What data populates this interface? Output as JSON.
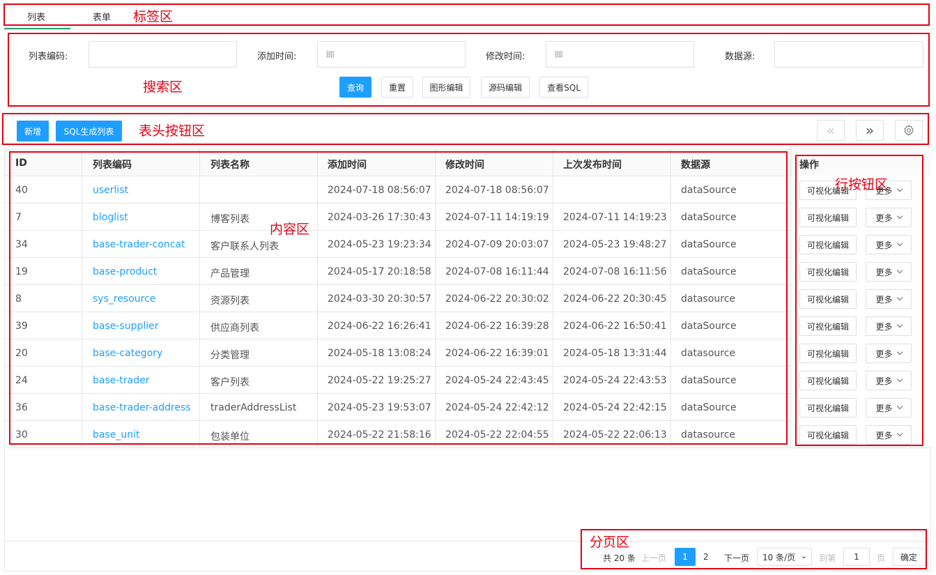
{
  "tabs": [
    {
      "label": "列表"
    },
    {
      "label": "表单"
    }
  ],
  "annotations": {
    "tabs_area": "标签区",
    "search_area": "搜索区",
    "toolbar_area": "表头按钮区",
    "content_area": "内容区",
    "row_buttons_area": "行按钮区",
    "pagination_area": "分页区"
  },
  "search": {
    "code_label": "列表编码:",
    "add_time_label": "添加时间:",
    "modify_time_label": "修改时间:",
    "datasource_label": "数据源:",
    "code_value": "",
    "datasource_value": "",
    "buttons": {
      "query": "查询",
      "reset": "重置",
      "graphic_edit": "图形编辑",
      "source_edit": "源码编辑",
      "view_sql": "查看SQL"
    }
  },
  "toolbar": {
    "add": "新增",
    "sql_generate": "SQL生成列表",
    "prev_icon": "double-chevron-left-icon",
    "next_icon": "double-chevron-right-icon",
    "settings_icon": "gear-icon"
  },
  "table": {
    "columns": [
      "ID",
      "列表编码",
      "列表名称",
      "添加时间",
      "修改时间",
      "上次发布时间",
      "数据源",
      "操作"
    ],
    "rows": [
      {
        "id": "40",
        "code": "userlist",
        "name": "",
        "added": "2024-07-18 08:56:07",
        "modified": "2024-07-18 08:56:07",
        "published": "",
        "datasource": "dataSource"
      },
      {
        "id": "7",
        "code": "bloglist",
        "name": "博客列表",
        "added": "2024-03-26 17:30:43",
        "modified": "2024-07-11 14:19:19",
        "published": "2024-07-11 14:19:23",
        "datasource": "dataSource"
      },
      {
        "id": "34",
        "code": "base-trader-concat",
        "name": "客户联系人列表",
        "added": "2024-05-23 19:23:34",
        "modified": "2024-07-09 20:03:07",
        "published": "2024-05-23 19:48:27",
        "datasource": "dataSource"
      },
      {
        "id": "19",
        "code": "base-product",
        "name": "产品管理",
        "added": "2024-05-17 20:18:58",
        "modified": "2024-07-08 16:11:44",
        "published": "2024-07-08 16:11:56",
        "datasource": "dataSource"
      },
      {
        "id": "8",
        "code": "sys_resource",
        "name": "资源列表",
        "added": "2024-03-30 20:30:57",
        "modified": "2024-06-22 20:30:02",
        "published": "2024-06-22 20:30:45",
        "datasource": "datasource"
      },
      {
        "id": "39",
        "code": "base-supplier",
        "name": "供应商列表",
        "added": "2024-06-22 16:26:41",
        "modified": "2024-06-22 16:39:28",
        "published": "2024-06-22 16:50:41",
        "datasource": "dataSource"
      },
      {
        "id": "20",
        "code": "base-category",
        "name": "分类管理",
        "added": "2024-05-18 13:08:24",
        "modified": "2024-06-22 16:39:01",
        "published": "2024-05-18 13:31:44",
        "datasource": "datasource"
      },
      {
        "id": "24",
        "code": "base-trader",
        "name": "客户列表",
        "added": "2024-05-22 19:25:27",
        "modified": "2024-05-24 22:43:45",
        "published": "2024-05-24 22:43:53",
        "datasource": "dataSource"
      },
      {
        "id": "36",
        "code": "base-trader-address",
        "name": "traderAddressList",
        "added": "2024-05-23 19:53:07",
        "modified": "2024-05-24 22:42:12",
        "published": "2024-05-24 22:42:15",
        "datasource": "dataSource"
      },
      {
        "id": "30",
        "code": "base_unit",
        "name": "包装单位",
        "added": "2024-05-22 21:58:16",
        "modified": "2024-05-22 22:04:55",
        "published": "2024-05-22 22:06:13",
        "datasource": "datasource"
      }
    ],
    "row_actions": {
      "visual_edit": "可视化编辑",
      "more": "更多"
    }
  },
  "pagination": {
    "total": "共 20 条",
    "prev": "上一页",
    "pages": [
      "1",
      "2"
    ],
    "current_page": "1",
    "next": "下一页",
    "page_size": "10 条/页",
    "goto_label": "到第",
    "goto_value": "1",
    "page_unit": "页",
    "confirm": "确定"
  },
  "colors": {
    "annotation": "#e60012",
    "primary": "#1e9fff",
    "tab_active": "#2e9e74"
  }
}
